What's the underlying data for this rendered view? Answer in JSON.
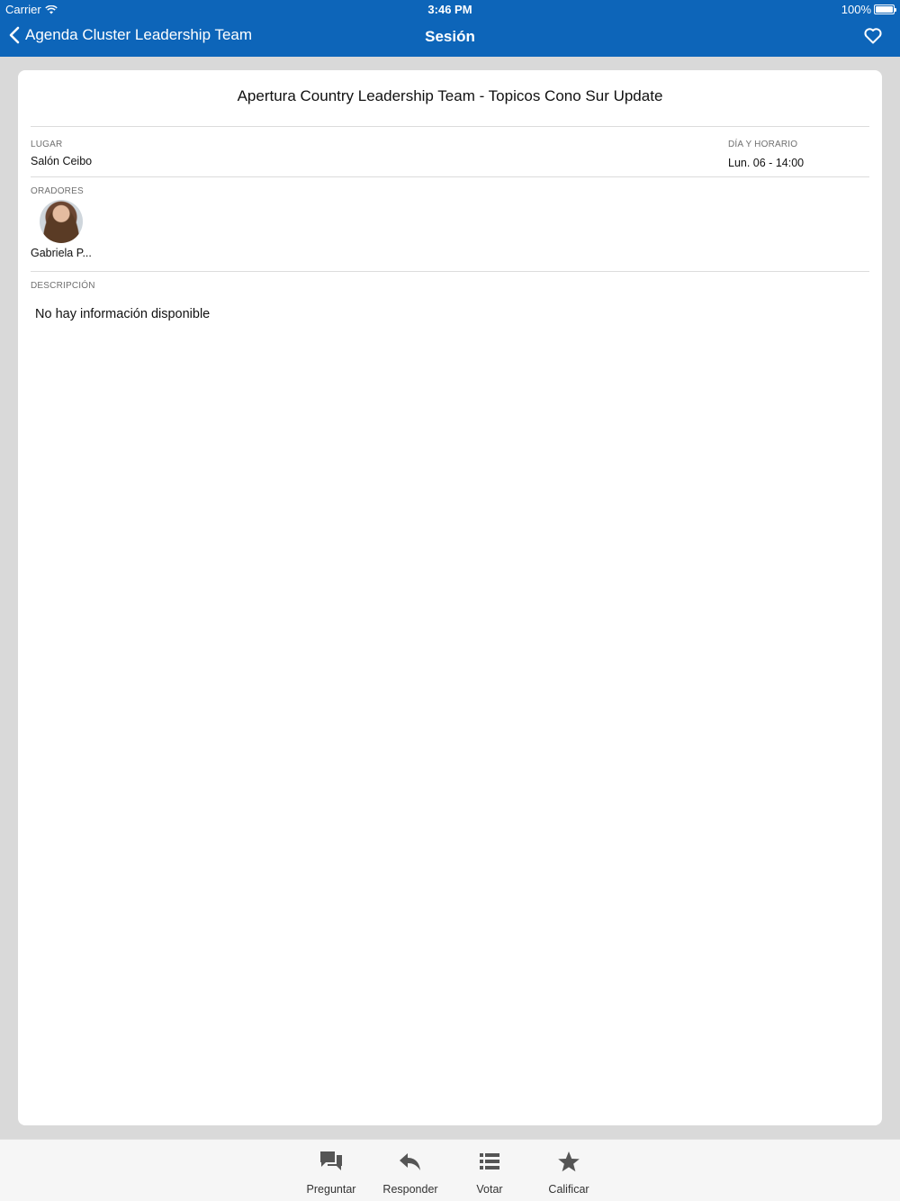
{
  "status_bar": {
    "carrier": "Carrier",
    "time": "3:46 PM",
    "battery": "100%"
  },
  "nav": {
    "back_label": "Agenda Cluster Leadership Team",
    "title": "Sesión",
    "favorite_icon": "heart-outline-icon"
  },
  "session": {
    "title": "Apertura Country Leadership Team - Topicos Cono Sur Update",
    "lugar_label": "LUGAR",
    "lugar_value": "Salón Ceibo",
    "dia_label": "DÍA Y HORARIO",
    "dia_value": "Lun. 06 - 14:00",
    "oradores_label": "ORADORES",
    "speakers": [
      {
        "name": "Gabriela P..."
      }
    ],
    "descripcion_label": "DESCRIPCIÓN",
    "descripcion_text": "No hay información disponible"
  },
  "tabs": [
    {
      "label": "Preguntar",
      "icon": "chat-bubbles-icon"
    },
    {
      "label": "Responder",
      "icon": "reply-arrow-icon"
    },
    {
      "label": "Votar",
      "icon": "list-icon"
    },
    {
      "label": "Calificar",
      "icon": "star-icon"
    }
  ],
  "colors": {
    "primary": "#0d65b9",
    "background": "#d9d9d9",
    "card": "#ffffff",
    "tab_bar": "#f6f6f6",
    "icon": "#555555"
  }
}
